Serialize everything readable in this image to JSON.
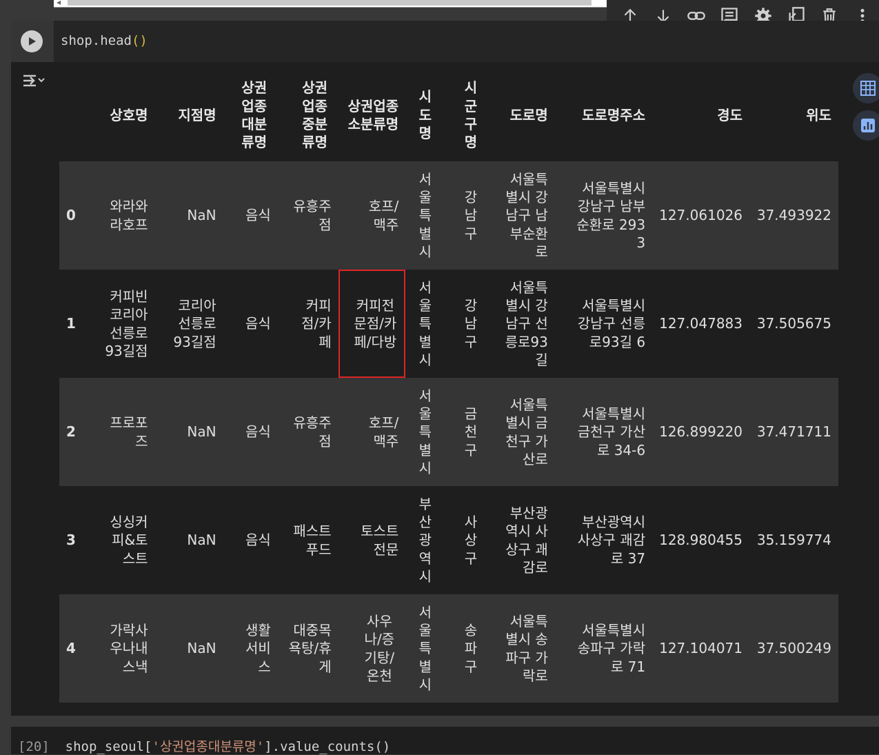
{
  "code_cell": {
    "code": "shop.head",
    "code_parens": "()"
  },
  "toolbar": {
    "icons": [
      "arrow-up-icon",
      "arrow-down-icon",
      "link-icon",
      "comment-icon",
      "gear-icon",
      "mirror-cell-icon",
      "trash-icon",
      "more-vert-icon"
    ]
  },
  "table": {
    "headers": {
      "index": "",
      "c1": "상호명",
      "c2": "지점명",
      "c3": "상권업종대분류명",
      "c4": "상권업종중분류명",
      "c5": "상권업종소분류명",
      "c6": "시도명",
      "c7": "시군구명",
      "c8": "도로명",
      "c9": "도로명주소",
      "c10": "경도",
      "c11": "위도"
    },
    "rows": [
      {
        "idx": "0",
        "c1": "와라와라호프",
        "c2": "NaN",
        "c3": "음식",
        "c4": "유흥주점",
        "c5": "호프/맥주",
        "c6": "서울특별시",
        "c7": "강남구",
        "c8": "서울특별시 강남구 남부순환로",
        "c9": "서울특별시 강남구 남부순환로 2933",
        "c10": "127.061026",
        "c11": "37.493922"
      },
      {
        "idx": "1",
        "c1": "커피빈코리아선릉로93길점",
        "c2": "코리아선릉로93길점",
        "c3": "음식",
        "c4": "커피점/카페",
        "c5": "커피전문점/카페/다방",
        "c6": "서울특별시",
        "c7": "강남구",
        "c8": "서울특별시 강남구 선릉로93길",
        "c9": "서울특별시 강남구 선릉로93길 6",
        "c10": "127.047883",
        "c11": "37.505675"
      },
      {
        "idx": "2",
        "c1": "프로포즈",
        "c2": "NaN",
        "c3": "음식",
        "c4": "유흥주점",
        "c5": "호프/맥주",
        "c6": "서울특별시",
        "c7": "금천구",
        "c8": "서울특별시 금천구 가산로",
        "c9": "서울특별시 금천구 가산로 34-6",
        "c10": "126.899220",
        "c11": "37.471711"
      },
      {
        "idx": "3",
        "c1": "싱싱커피&토스트",
        "c2": "NaN",
        "c3": "음식",
        "c4": "패스트푸드",
        "c5": "토스트전문",
        "c6": "부산광역시",
        "c7": "사상구",
        "c8": "부산광역시 사상구 괘감로",
        "c9": "부산광역시 사상구 괘감로 37",
        "c10": "128.980455",
        "c11": "35.159774"
      },
      {
        "idx": "4",
        "c1": "가락사우나내스낵",
        "c2": "NaN",
        "c3": "생활서비스",
        "c4": "대중목욕탕/휴게",
        "c5": "사우나/증기탕/온천",
        "c6": "서울특별시",
        "c7": "송파구",
        "c8": "서울특별시 송파구 가락로",
        "c9": "서울특별시 송파구 가락로 71",
        "c10": "127.104071",
        "c11": "37.500249"
      }
    ]
  },
  "next_cell": {
    "prompt": "[20]",
    "code_pre": "shop_seoul[",
    "code_str": "'상권업종대분류명'",
    "code_post": "].value_counts()"
  }
}
